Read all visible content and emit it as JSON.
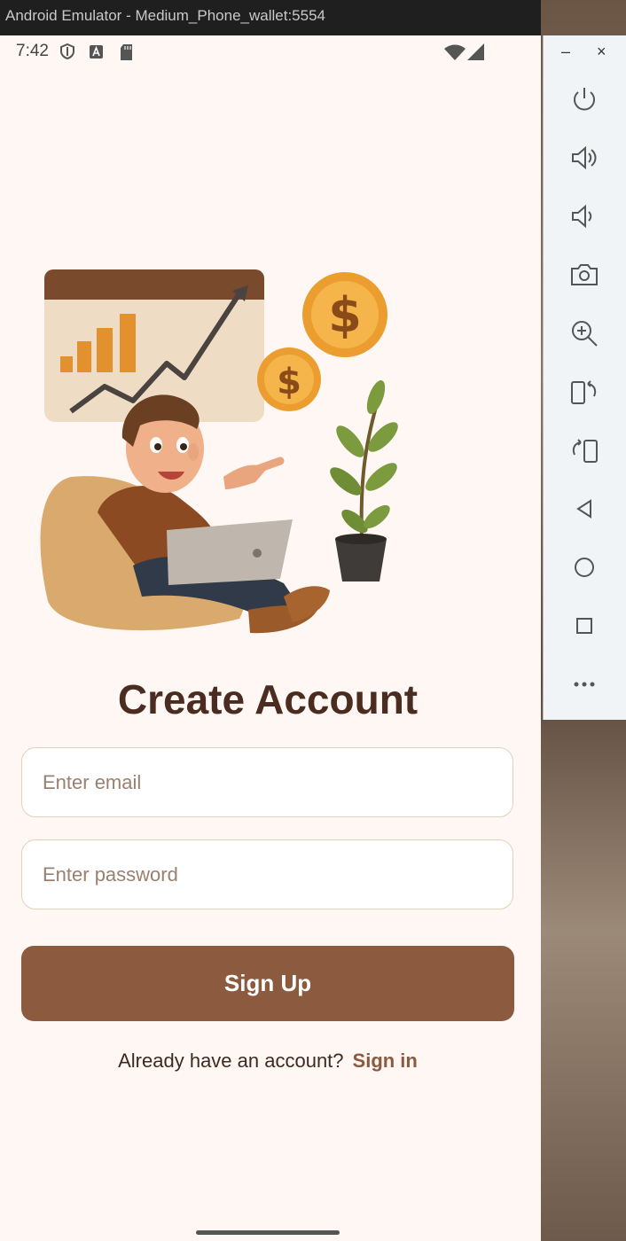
{
  "window": {
    "title": "Android Emulator - Medium_Phone_wallet:5554"
  },
  "status_bar": {
    "time": "7:42",
    "icons": [
      "shield-icon",
      "font-a-icon",
      "sd-card-icon",
      "wifi-icon",
      "cell-signal-icon"
    ]
  },
  "screen": {
    "title": "Create Account",
    "email": {
      "value": "",
      "placeholder": "Enter email"
    },
    "password": {
      "value": "",
      "placeholder": "Enter password"
    },
    "signup_label": "Sign Up",
    "signin_prompt": "Already have an account?",
    "signin_link": "Sign in"
  },
  "emulator_controls": {
    "window_buttons": {
      "minimize": "–",
      "close": "×"
    },
    "buttons": [
      "power-icon",
      "volume-up-icon",
      "volume-down-icon",
      "camera-icon",
      "zoom-icon",
      "rotate-left-icon",
      "rotate-right-icon",
      "back-icon",
      "home-icon",
      "overview-icon",
      "more-icon"
    ]
  },
  "colors": {
    "accent": "#8b5a3f",
    "title": "#4a2c20",
    "background": "#fff7f3"
  }
}
